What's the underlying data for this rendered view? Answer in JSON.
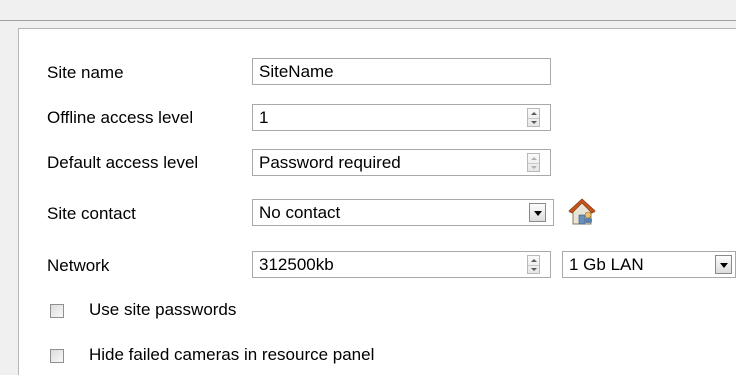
{
  "form": {
    "site_name": {
      "label": "Site name",
      "value": "SiteName"
    },
    "offline_access_level": {
      "label": "Offline access level",
      "value": "1"
    },
    "default_access_level": {
      "label": "Default access level",
      "value": "Password required"
    },
    "site_contact": {
      "label": "Site contact",
      "value": "No contact"
    },
    "network": {
      "label": "Network",
      "value": "312500kb",
      "type_value": "1 Gb LAN"
    },
    "use_site_passwords": {
      "label": "Use site passwords",
      "checked": false
    },
    "hide_failed_cameras": {
      "label": "Hide failed cameras in resource panel",
      "checked": false
    }
  },
  "icons": {
    "contact_button": "house-contact-icon",
    "spin_buttons": "spin-up-down-icon",
    "dropdown_arrow": "chevron-down-icon"
  },
  "colors": {
    "panel_background": "#ffffff",
    "window_background": "#f0f0f0",
    "field_border": "#a9a9a9",
    "house_roof": "#c8551e"
  }
}
